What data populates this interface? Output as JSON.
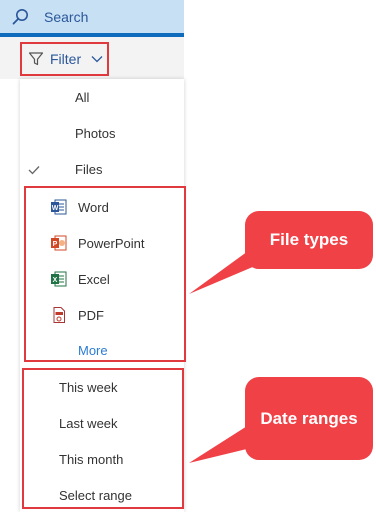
{
  "search": {
    "label": "Search"
  },
  "filter": {
    "label": "Filter"
  },
  "menu": {
    "types": [
      {
        "label": "All",
        "checked": false
      },
      {
        "label": "Photos",
        "checked": false
      },
      {
        "label": "Files",
        "checked": true
      }
    ],
    "file_types": [
      {
        "label": "Word",
        "icon": "word-icon"
      },
      {
        "label": "PowerPoint",
        "icon": "powerpoint-icon"
      },
      {
        "label": "Excel",
        "icon": "excel-icon"
      },
      {
        "label": "PDF",
        "icon": "pdf-icon"
      }
    ],
    "more_label": "More",
    "date_ranges": [
      "This week",
      "Last week",
      "This month",
      "Select range"
    ]
  },
  "callouts": {
    "file_types": "File types",
    "date_ranges": "Date ranges"
  },
  "colors": {
    "accent": "#0f6cbd",
    "highlight": "#e0393e",
    "callout": "#f04147",
    "link": "#2b7cd3"
  }
}
